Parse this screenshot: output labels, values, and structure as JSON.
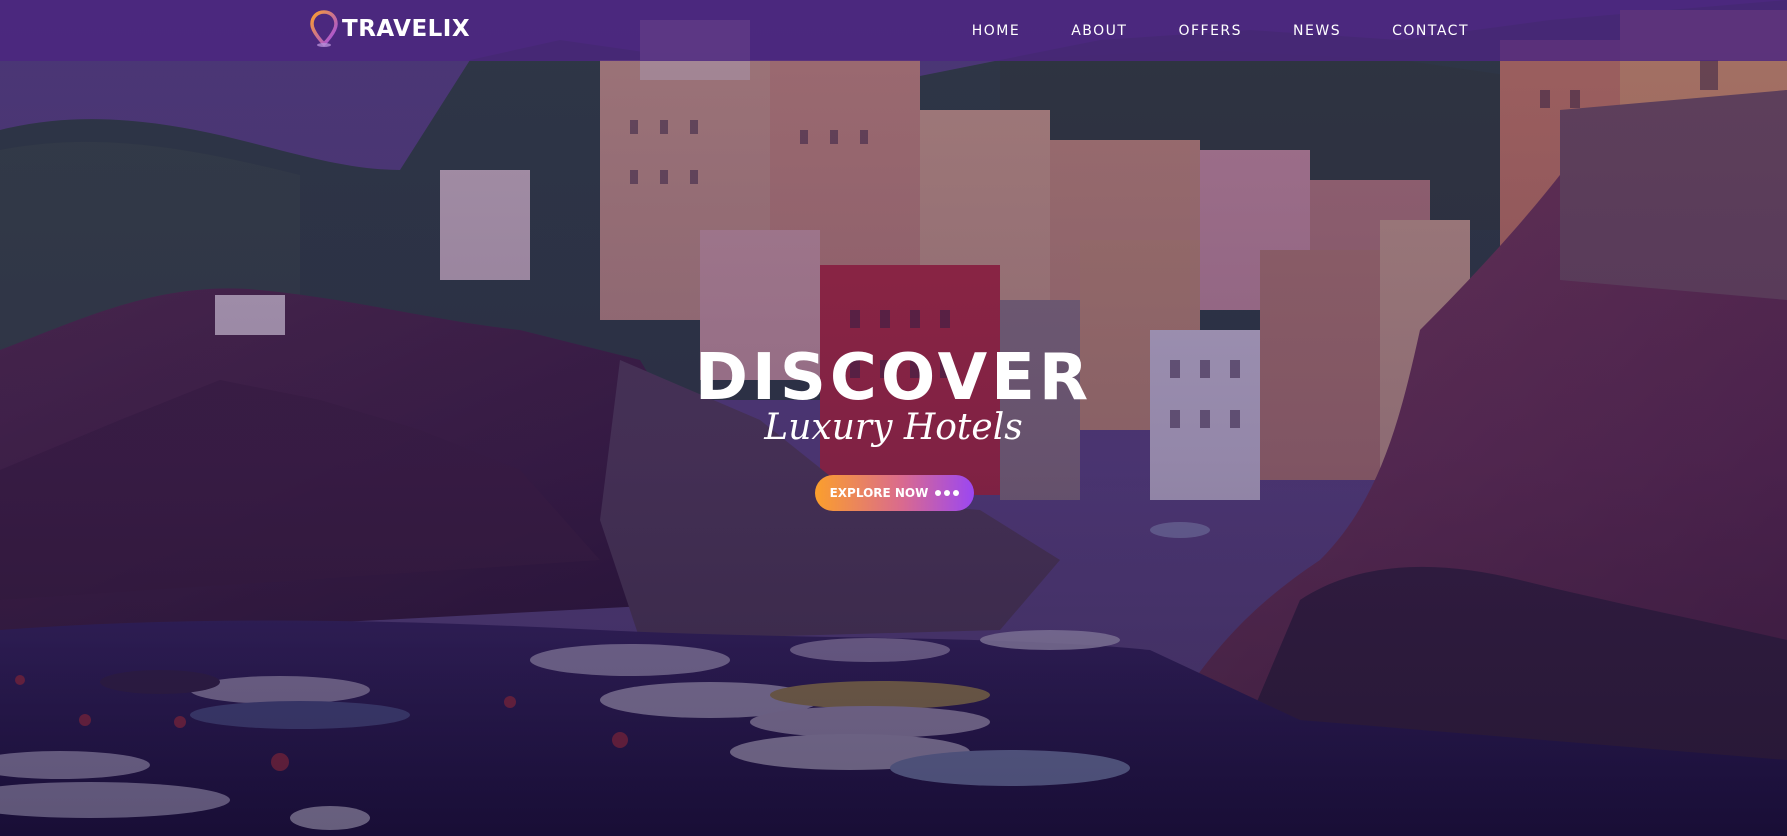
{
  "header": {
    "logo_text": "TRAVELIX",
    "logo_icon": "map-pin-icon",
    "nav": [
      {
        "label": "HOME"
      },
      {
        "label": "ABOUT"
      },
      {
        "label": "OFFERS"
      },
      {
        "label": "NEWS"
      },
      {
        "label": "CONTACT"
      }
    ]
  },
  "hero": {
    "title": "DISCOVER",
    "subtitle": "Luxury Hotels",
    "cta_label": "EXPLORE NOW",
    "cta_icon": "dots-icon"
  },
  "colors": {
    "header_bg": "#4c2680",
    "accent_orange": "#fb9f2c",
    "accent_purple": "#9b47f2",
    "overlay": "#2e1258"
  }
}
